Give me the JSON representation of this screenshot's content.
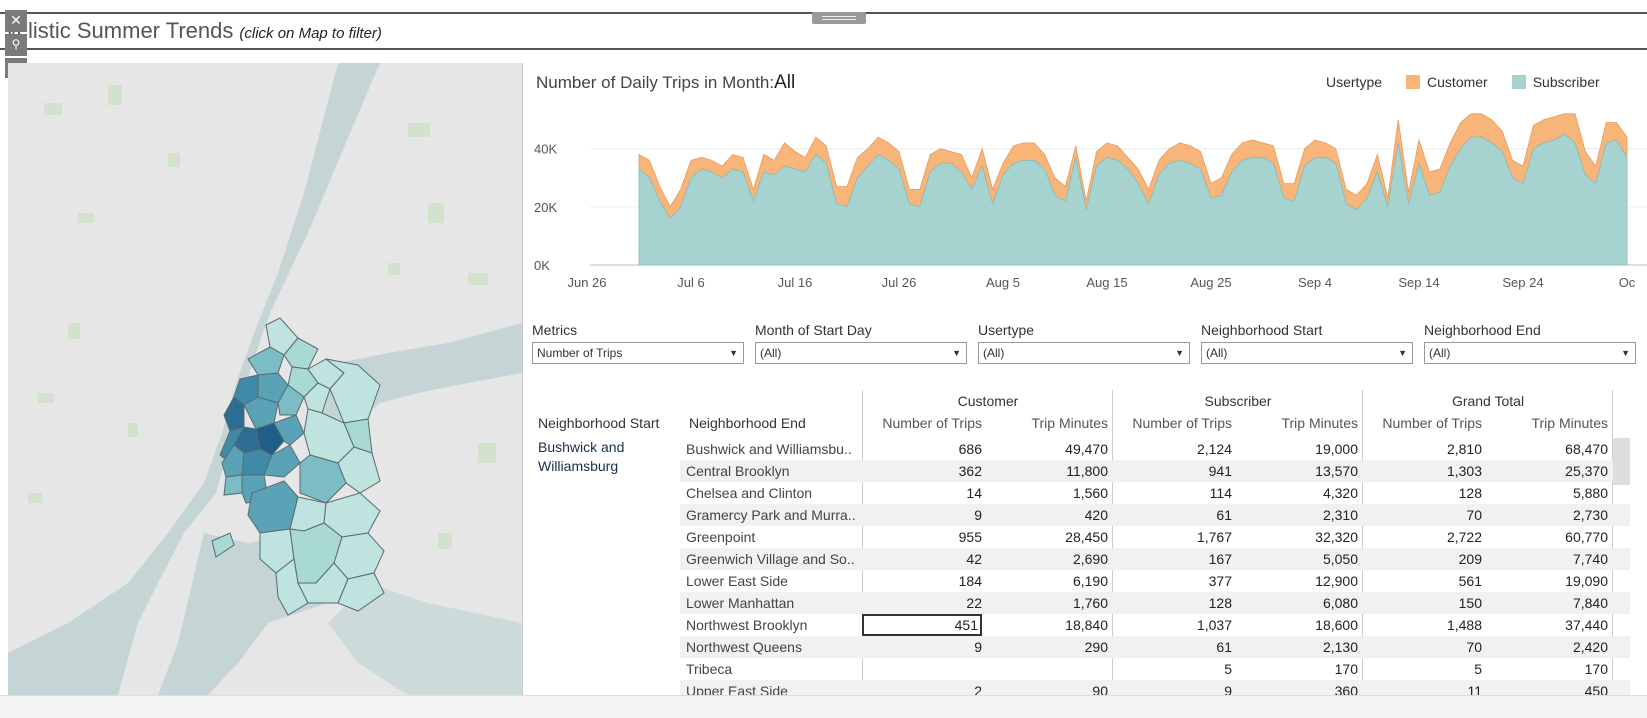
{
  "dashboard": {
    "title": "yclistic Summer Trends",
    "title_hint": "(click on Map to filter)"
  },
  "controls": {
    "close_glyph": "✕",
    "pin_glyph": "⚲",
    "dropdown_glyph": "▾"
  },
  "chart": {
    "title_prefix": "Number of Daily Trips in Month:",
    "title_value": "All",
    "legend_title": "Usertype",
    "legend": [
      {
        "label": "Customer",
        "color": "#f7b57a"
      },
      {
        "label": "Subscriber",
        "color": "#a6d3d0"
      }
    ]
  },
  "chart_data": {
    "type": "area",
    "title": "Number of Daily Trips in Month:All",
    "legend_title": "Usertype",
    "x_ticks": [
      "Jun 26",
      "Jul 6",
      "Jul 16",
      "Jul 26",
      "Aug 5",
      "Aug 15",
      "Aug 25",
      "Sep 4",
      "Sep 14",
      "Sep 24",
      "Oc"
    ],
    "y_ticks": [
      "0K",
      "20K",
      "40K"
    ],
    "ylim": [
      0,
      54000
    ],
    "stacked": true,
    "x_start": "Jul 1",
    "series": [
      {
        "name": "Subscriber",
        "color": "#a6d3d0",
        "values": [
          33000,
          30000,
          22000,
          16000,
          20000,
          30000,
          33000,
          32000,
          30000,
          33000,
          32000,
          22000,
          32000,
          31000,
          34000,
          33000,
          32000,
          38000,
          35000,
          21000,
          20000,
          30000,
          34000,
          38000,
          36000,
          33000,
          21000,
          20000,
          32000,
          35000,
          35000,
          32000,
          26000,
          34000,
          21000,
          31000,
          35000,
          36000,
          36000,
          33000,
          24000,
          22000,
          37000,
          19000,
          34000,
          37000,
          36000,
          33000,
          28000,
          21000,
          31000,
          35000,
          36000,
          35000,
          33000,
          23000,
          24000,
          32000,
          36000,
          37000,
          37000,
          35000,
          23000,
          22000,
          34000,
          37000,
          37000,
          35000,
          21000,
          19000,
          23000,
          32000,
          20000,
          42000,
          21000,
          35000,
          24000,
          25000,
          34000,
          40000,
          44000,
          44000,
          42000,
          39000,
          30000,
          28000,
          40000,
          42000,
          43000,
          45000,
          42000,
          31000,
          28000,
          42000,
          43000,
          37000
        ]
      },
      {
        "name": "Customer",
        "color": "#f7b57a",
        "values": [
          5000,
          6000,
          5000,
          4000,
          6000,
          6000,
          4000,
          4000,
          4000,
          5000,
          5000,
          4000,
          6000,
          5000,
          8000,
          6000,
          5000,
          6000,
          6000,
          6000,
          7000,
          7000,
          6000,
          6000,
          6000,
          6000,
          5000,
          6000,
          6000,
          5000,
          4000,
          6000,
          4000,
          6000,
          5000,
          4000,
          6000,
          6000,
          6000,
          5000,
          6000,
          5000,
          4000,
          3000,
          5000,
          5000,
          5000,
          4000,
          5000,
          5000,
          5000,
          5000,
          6000,
          6000,
          6000,
          5000,
          6000,
          6000,
          6000,
          6000,
          5000,
          6000,
          5000,
          6000,
          6000,
          6000,
          5000,
          5000,
          5000,
          5000,
          5000,
          6000,
          3000,
          8000,
          4000,
          8000,
          8000,
          8000,
          8000,
          9000,
          8000,
          8000,
          8000,
          7000,
          6000,
          6000,
          8000,
          8000,
          8000,
          7000,
          10000,
          8000,
          6000,
          7000,
          6000,
          7000
        ]
      }
    ]
  },
  "filters": [
    {
      "label": "Metrics",
      "value": "Number of Trips"
    },
    {
      "label": "Month of Start Day",
      "value": "(All)"
    },
    {
      "label": "Usertype",
      "value": "(All)"
    },
    {
      "label": "Neighborhood Start",
      "value": "(All)"
    },
    {
      "label": "Neighborhood End",
      "value": "(All)"
    }
  ],
  "table": {
    "group_headers": [
      "Customer",
      "Subscriber",
      "Grand Total"
    ],
    "row_headers": [
      "Neighborhood Start",
      "Neighborhood End"
    ],
    "measure_headers": [
      "Number of Trips",
      "Trip Minutes",
      "Number of Trips",
      "Trip Minutes",
      "Number of Trips",
      "Trip Minutes"
    ],
    "neighborhood_start": "Bushwick and Williamsburg",
    "rows": [
      {
        "end": "Bushwick and Williamsbu..",
        "c_trips": "686",
        "c_min": "49,470",
        "s_trips": "2,124",
        "s_min": "19,000",
        "g_trips": "2,810",
        "g_min": "68,470"
      },
      {
        "end": "Central Brooklyn",
        "c_trips": "362",
        "c_min": "11,800",
        "s_trips": "941",
        "s_min": "13,570",
        "g_trips": "1,303",
        "g_min": "25,370"
      },
      {
        "end": "Chelsea and Clinton",
        "c_trips": "14",
        "c_min": "1,560",
        "s_trips": "114",
        "s_min": "4,320",
        "g_trips": "128",
        "g_min": "5,880"
      },
      {
        "end": "Gramercy Park and Murra..",
        "c_trips": "9",
        "c_min": "420",
        "s_trips": "61",
        "s_min": "2,310",
        "g_trips": "70",
        "g_min": "2,730"
      },
      {
        "end": "Greenpoint",
        "c_trips": "955",
        "c_min": "28,450",
        "s_trips": "1,767",
        "s_min": "32,320",
        "g_trips": "2,722",
        "g_min": "60,770"
      },
      {
        "end": "Greenwich Village and So..",
        "c_trips": "42",
        "c_min": "2,690",
        "s_trips": "167",
        "s_min": "5,050",
        "g_trips": "209",
        "g_min": "7,740"
      },
      {
        "end": "Lower East Side",
        "c_trips": "184",
        "c_min": "6,190",
        "s_trips": "377",
        "s_min": "12,900",
        "g_trips": "561",
        "g_min": "19,090"
      },
      {
        "end": "Lower Manhattan",
        "c_trips": "22",
        "c_min": "1,760",
        "s_trips": "128",
        "s_min": "6,080",
        "g_trips": "150",
        "g_min": "7,840"
      },
      {
        "end": "Northwest Brooklyn",
        "c_trips": "451",
        "c_min": "18,840",
        "s_trips": "1,037",
        "s_min": "18,600",
        "g_trips": "1,488",
        "g_min": "37,440"
      },
      {
        "end": "Northwest Queens",
        "c_trips": "9",
        "c_min": "290",
        "s_trips": "61",
        "s_min": "2,130",
        "g_trips": "70",
        "g_min": "2,420"
      },
      {
        "end": "Tribeca",
        "c_trips": "",
        "c_min": "",
        "s_trips": "5",
        "s_min": "170",
        "g_trips": "5",
        "g_min": "170"
      },
      {
        "end": "Upper East Side",
        "c_trips": "2",
        "c_min": "90",
        "s_trips": "9",
        "s_min": "360",
        "g_trips": "11",
        "g_min": "450"
      }
    ]
  }
}
